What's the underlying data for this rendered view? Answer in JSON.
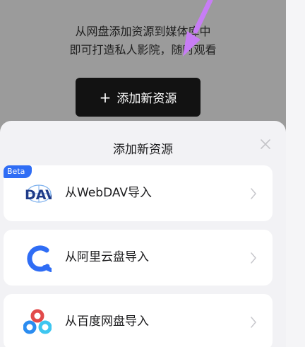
{
  "intro": {
    "line1": "从网盘添加资源到媒体库中",
    "line2": "即可打造私人影院，随时观看"
  },
  "add_button": {
    "icon": "plus-icon",
    "label": "添加新资源"
  },
  "sheet": {
    "title": "添加新资源",
    "close_icon": "close-icon",
    "sources": [
      {
        "label": "从WebDAV导入",
        "logo_text": "DAV",
        "badge": "Beta",
        "icon": "webdav-logo-icon"
      },
      {
        "label": "从阿里云盘导入",
        "icon": "aliyun-drive-logo-icon"
      },
      {
        "label": "从百度网盘导入",
        "icon": "baidu-netdisk-logo-icon"
      }
    ]
  },
  "colors": {
    "backdrop": "#9b9b9b",
    "button": "#121212",
    "sheet": "#f2f2f5",
    "card": "#ffffff",
    "accent_blue": "#2f6df5",
    "annotation_arrow": "#c77df5"
  }
}
